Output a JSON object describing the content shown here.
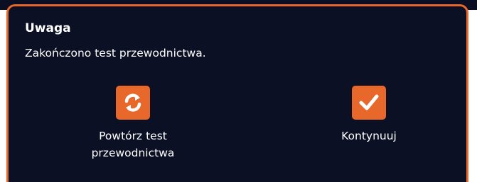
{
  "dialog": {
    "title": "Uwaga",
    "message": "Zakończono test przewodnictwa.",
    "actions": [
      {
        "icon": "refresh-icon",
        "label_line1": "Powtórz test",
        "label_line2": "przewodnictwa"
      },
      {
        "icon": "checkmark-icon",
        "label_line1": "Kontynuuj"
      }
    ]
  },
  "colors": {
    "background": "#0b1024",
    "accent": "#e8672a",
    "text": "#ffffff"
  }
}
